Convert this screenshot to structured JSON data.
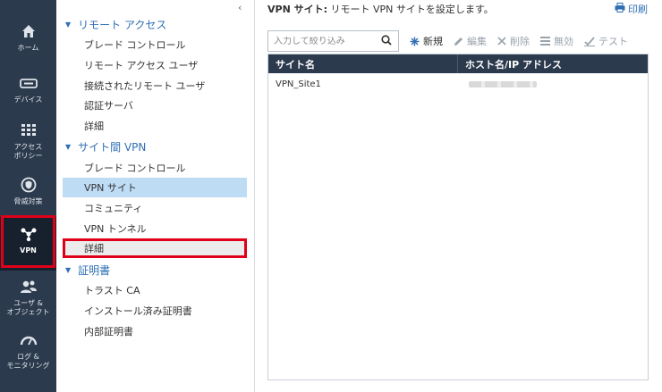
{
  "rail": {
    "items": [
      {
        "key": "home",
        "label": "ホーム",
        "icon": "home-icon"
      },
      {
        "key": "devices",
        "label": "デバイス",
        "icon": "device-icon"
      },
      {
        "key": "access-policy",
        "label": "アクセス\nポリシー",
        "icon": "grid-icon"
      },
      {
        "key": "threat",
        "label": "脅威対策",
        "icon": "shield-icon"
      },
      {
        "key": "vpn",
        "label": "VPN",
        "icon": "network-icon",
        "active": true
      },
      {
        "key": "users",
        "label": "ユーザ &\nオブジェクト",
        "icon": "users-icon"
      },
      {
        "key": "logs",
        "label": "ログ &\nモニタリング",
        "icon": "gauge-icon"
      }
    ]
  },
  "tree": {
    "collapse_glyph": "‹",
    "sections": [
      {
        "title": "リモート アクセス",
        "items": [
          "ブレード コントロール",
          "リモート アクセス ユーザ",
          "接続されたリモート ユーザ",
          "認証サーバ",
          "詳細"
        ]
      },
      {
        "title": "サイト間 VPN",
        "items": [
          "ブレード コントロール",
          "VPN サイト",
          "コミュニティ",
          "VPN トンネル",
          "詳細"
        ]
      },
      {
        "title": "証明書",
        "items": [
          "トラスト CA",
          "インストール済み証明書",
          "内部証明書"
        ]
      }
    ],
    "selected": "VPN サイト"
  },
  "main": {
    "title_bold": "VPN サイト:",
    "title_rest": " リモート VPN サイトを設定します。",
    "print_label": "印刷",
    "search_placeholder": "入力して絞り込み",
    "toolbar": {
      "new": "新規",
      "edit": "編集",
      "delete": "削除",
      "disable": "無効",
      "test": "テスト"
    },
    "grid": {
      "headers": [
        "サイト名",
        "ホスト名/IP アドレス"
      ],
      "rows": [
        {
          "site": "VPN_Site1"
        }
      ]
    }
  },
  "colors": {
    "rail_bg": "#2c3a4d",
    "accent": "#2f6fb5",
    "selected_bg": "#bfdcf5",
    "highlight_red": "#e1001a"
  }
}
